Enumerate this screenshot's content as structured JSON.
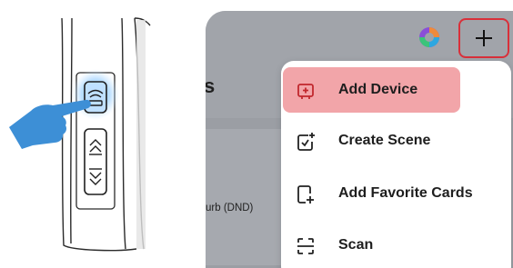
{
  "illustration": {
    "buttons": [
      "assistant-button-icon",
      "volume-up-icon",
      "volume-down-icon"
    ],
    "colors": {
      "highlight": "#8ec8ff",
      "hand": "#3d8fd6"
    }
  },
  "app": {
    "partial_heading": "s",
    "partial_dnd_label": "urb (DND)",
    "assistant_icon": "assistant-icon",
    "add_button_icon": "plus-icon",
    "menu": {
      "items": [
        {
          "label": "Add Device",
          "icon": "add-device-icon",
          "selected": true
        },
        {
          "label": "Create Scene",
          "icon": "create-scene-icon",
          "selected": false
        },
        {
          "label": "Add Favorite Cards",
          "icon": "add-favorite-cards-icon",
          "selected": false
        },
        {
          "label": "Scan",
          "icon": "scan-icon",
          "selected": false
        }
      ]
    },
    "colors": {
      "accent_red": "#d9303a",
      "selection": "#f2a5a9",
      "dim_bg": "#9fa3aa"
    }
  }
}
